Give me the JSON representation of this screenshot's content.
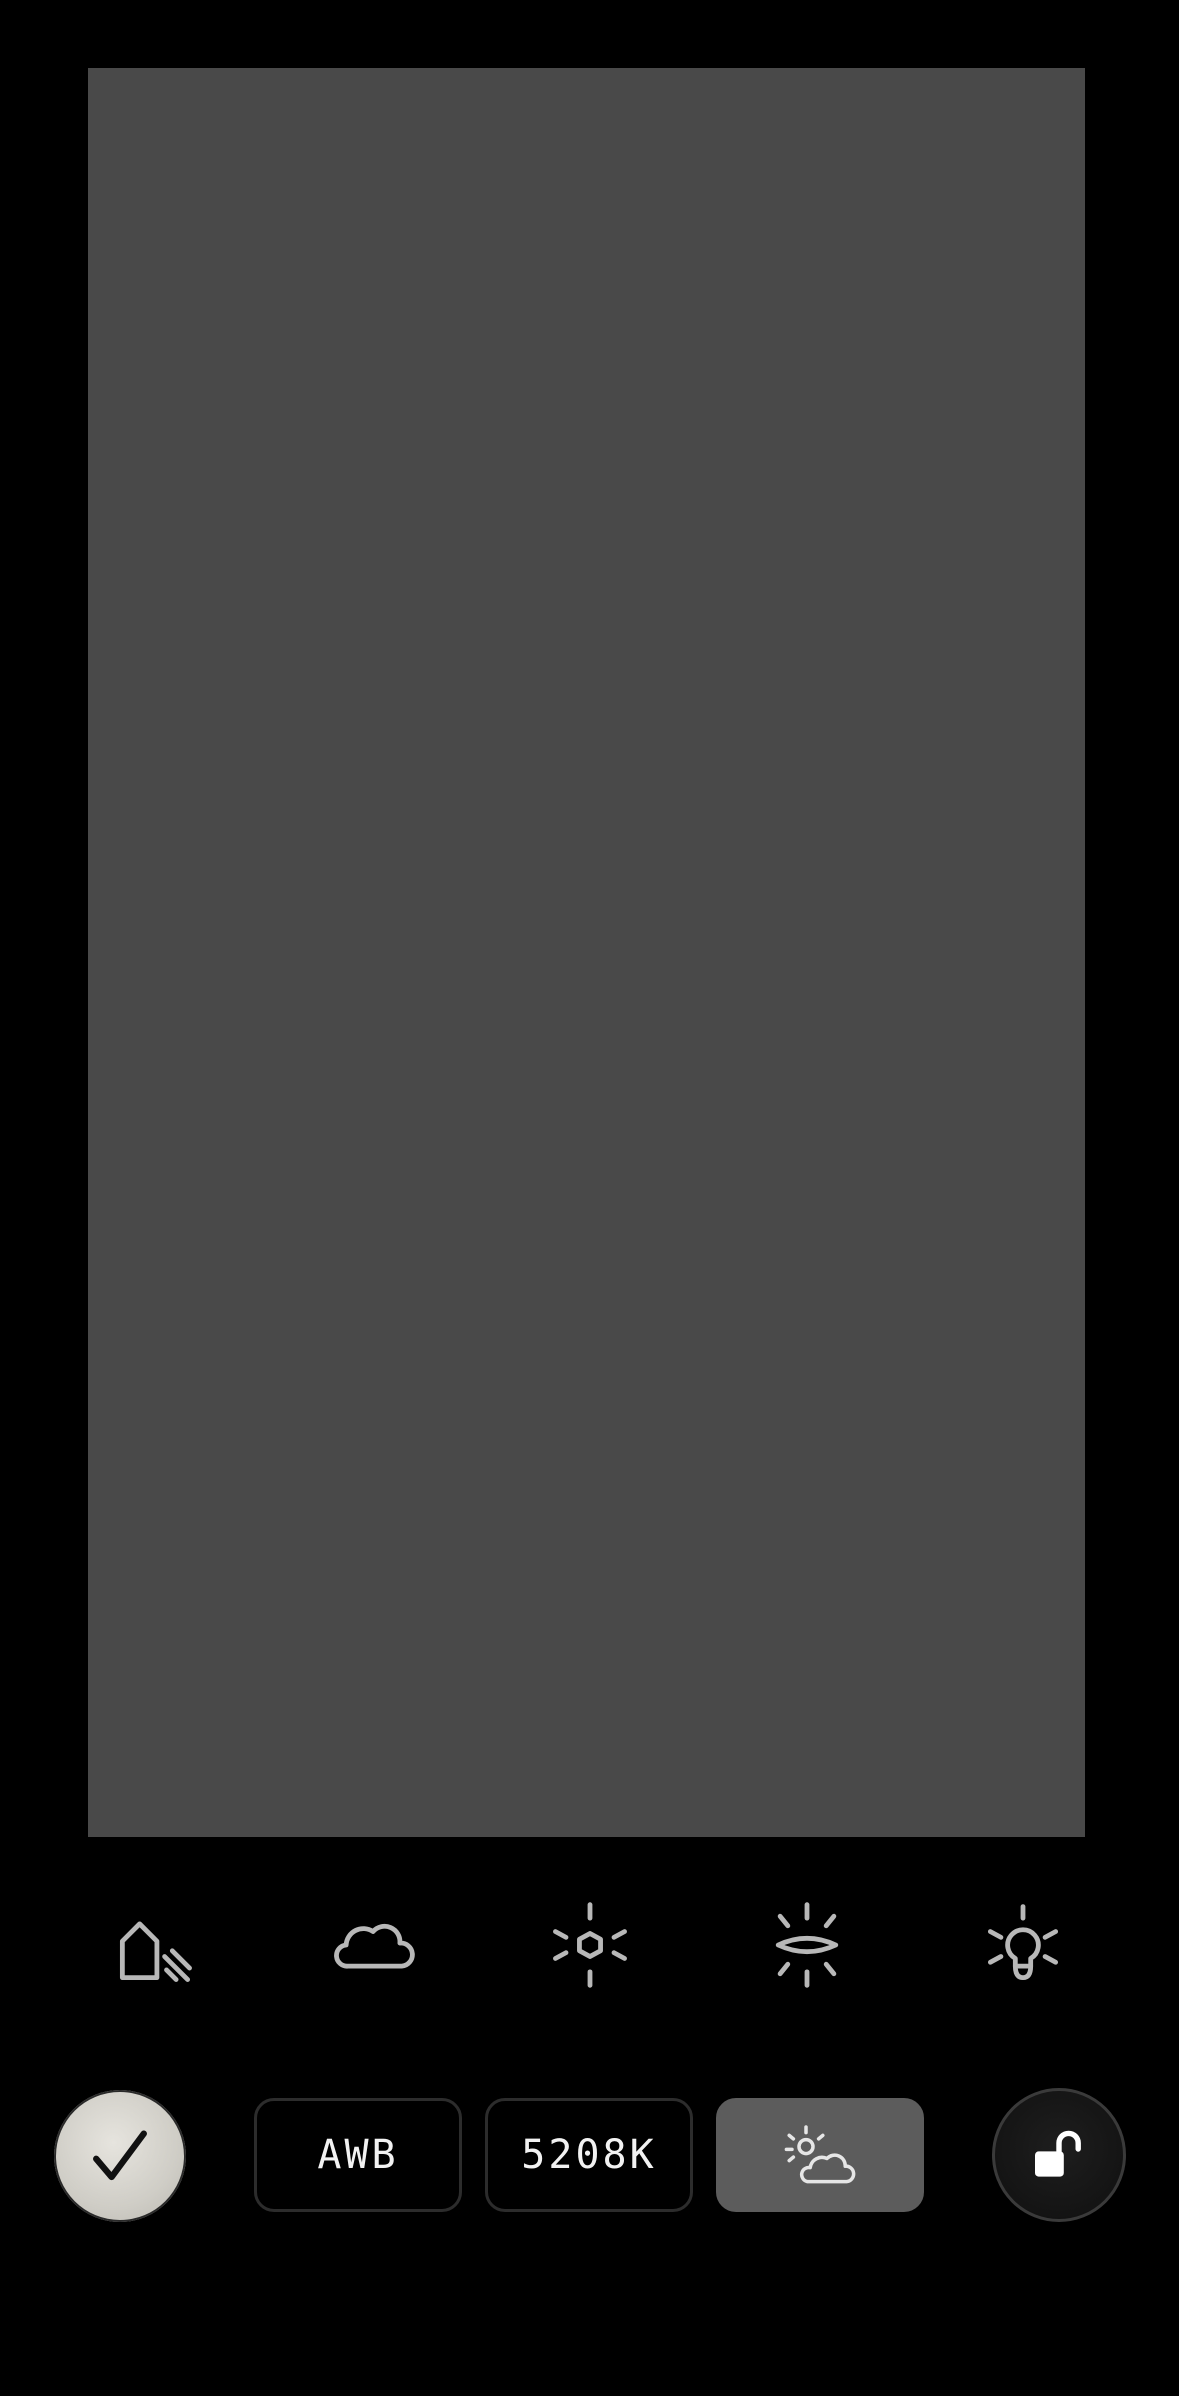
{
  "viewfinder": {
    "background_color": "#494949"
  },
  "presets": [
    {
      "icon": "shade-icon"
    },
    {
      "icon": "cloud-icon"
    },
    {
      "icon": "sun-icon"
    },
    {
      "icon": "fluorescent-icon"
    },
    {
      "icon": "incandescent-bulb-icon"
    }
  ],
  "controls": {
    "confirm_icon": "checkmark-icon",
    "awb_label": "AWB",
    "kelvin_label": "5208K",
    "active_preset_icon": "partly-cloudy-icon",
    "lock_icon": "unlocked-padlock-icon"
  },
  "colors": {
    "background": "#000000",
    "active_pill": "#5c5c5c",
    "icon_stroke": "#b8b8b8",
    "confirm_fill": "#d2d0c9"
  }
}
